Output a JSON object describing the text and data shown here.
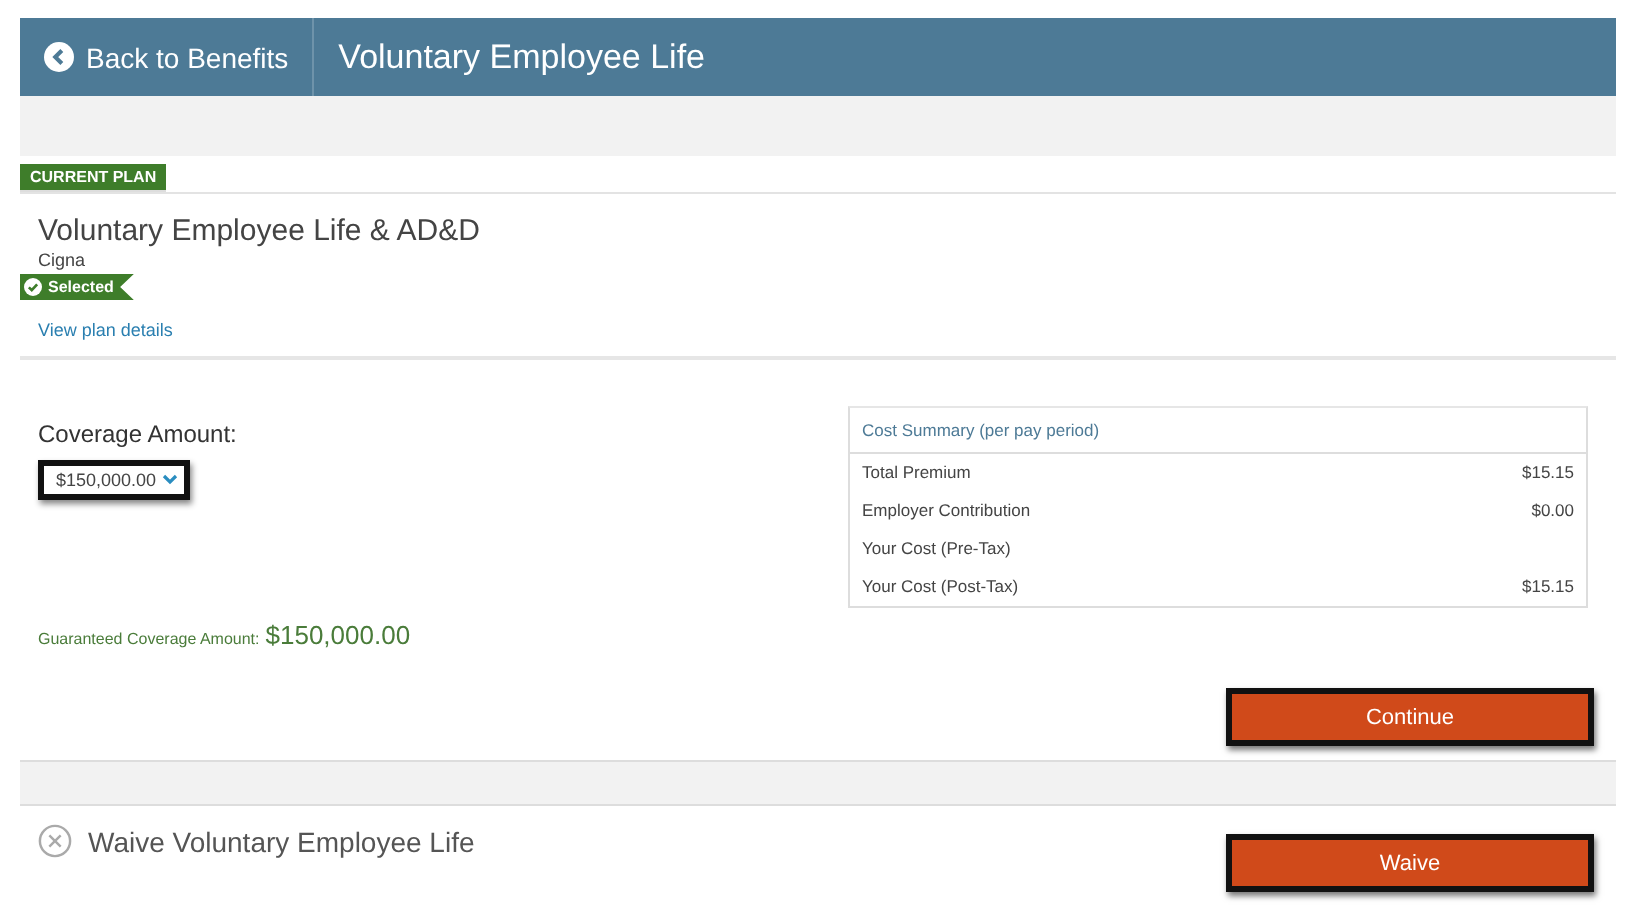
{
  "header": {
    "back_link": "Back to Benefits",
    "title": "Voluntary Employee Life"
  },
  "plan": {
    "badge": "CURRENT PLAN",
    "name": "Voluntary Employee Life & AD&D",
    "carrier": "Cigna",
    "selected": true,
    "selected_label": "Selected",
    "details_link": "View plan details"
  },
  "coverage": {
    "label": "Coverage Amount:",
    "value": "$150,000.00",
    "guaranteed_label": "Guaranteed Coverage Amount:",
    "guaranteed_value": "$150,000.00"
  },
  "cost_summary": {
    "title": "Cost Summary (per pay period)",
    "rows": [
      {
        "label": "Total Premium",
        "value": "$15.15"
      },
      {
        "label": "Employer Contribution",
        "value": "$0.00"
      },
      {
        "label": "Your Cost (Pre-Tax)"
      },
      {
        "label": "Your Cost (Post-Tax)",
        "value": "$15.15"
      }
    ]
  },
  "continue_button": "Continue",
  "waive": {
    "label": "Waive Voluntary Employee Life",
    "button": "Waive"
  }
}
